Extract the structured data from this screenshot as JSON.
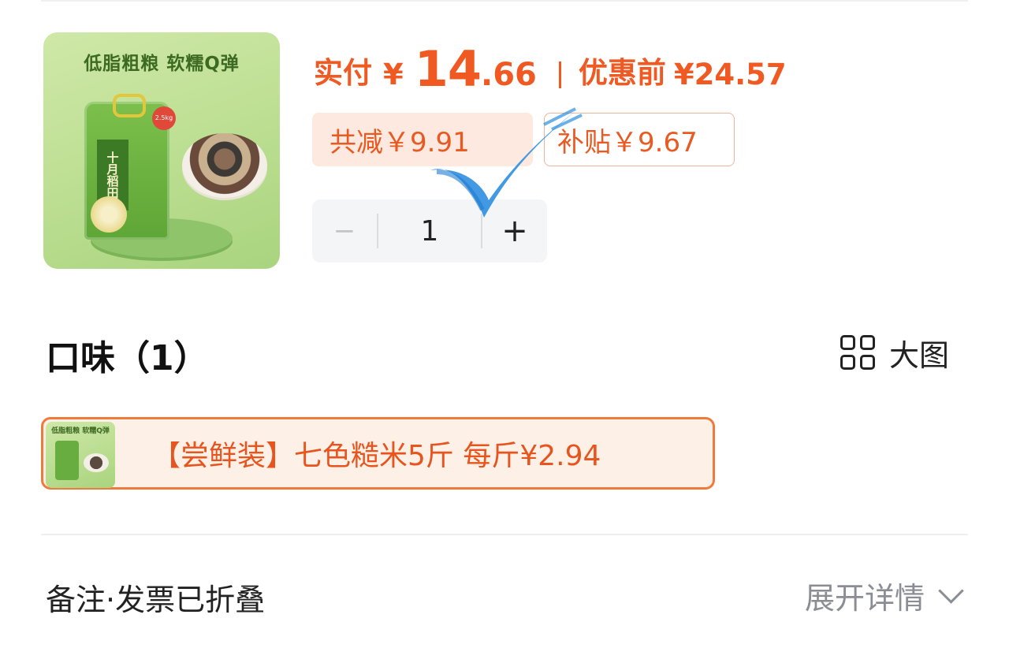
{
  "product": {
    "slogan": "低脂粗粮 软糯Q弹",
    "bag_label": "十月稻田",
    "bag_weight": "2.5kg"
  },
  "price": {
    "paid_label": "实付",
    "paid_currency": "¥",
    "paid_int": "14",
    "paid_cents": ".66",
    "before_label": "优惠前",
    "before_value": "¥24.57"
  },
  "discounts": {
    "total": "共减￥9.91",
    "subsidy": "补贴￥9.67"
  },
  "quantity": {
    "minus": "−",
    "value": "1",
    "plus": "+"
  },
  "flavor": {
    "title": "口味（1）",
    "big_view_label": "大图",
    "option_thumb_text": "低脂粗粮 软糯Q弹",
    "option_label": "【尝鲜装】七色糙米5斤 每斤¥2.94"
  },
  "remark": {
    "label": "备注·发票已折叠",
    "expand_label": "展开详情"
  },
  "colors": {
    "accent": "#f05a22",
    "check": "#2f8fe0"
  }
}
